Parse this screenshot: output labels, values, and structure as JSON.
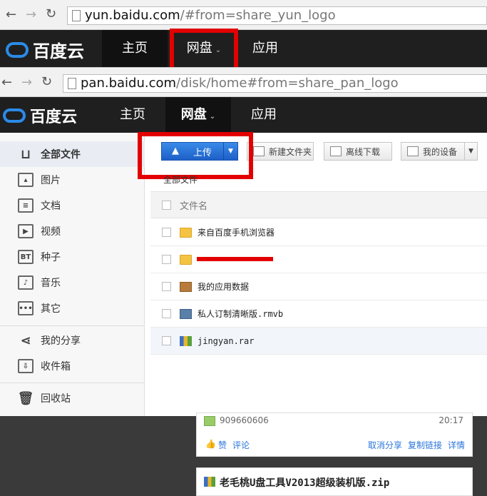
{
  "browser_top": {
    "url_host": "yun.baidu.com",
    "url_rest": "/#from=share_yun_logo"
  },
  "nav_top": {
    "logo": "百度云",
    "items": [
      "主页",
      "网盘",
      "应用"
    ]
  },
  "browser_second": {
    "url_host": "pan.baidu.com",
    "url_rest": "/disk/home#from=share_pan_logo"
  },
  "nav_second": {
    "logo": "百度云",
    "items": [
      "主页",
      "网盘",
      "应用"
    ]
  },
  "sidebar": {
    "items": [
      {
        "label": "全部文件",
        "icon": "folder-tray-icon"
      },
      {
        "label": "图片",
        "icon": "image-icon"
      },
      {
        "label": "文档",
        "icon": "document-icon"
      },
      {
        "label": "视频",
        "icon": "video-icon"
      },
      {
        "label": "种子",
        "icon": "bt-icon",
        "glyph": "BT"
      },
      {
        "label": "音乐",
        "icon": "music-icon"
      },
      {
        "label": "其它",
        "icon": "more-icon"
      },
      {
        "label": "我的分享",
        "icon": "share-icon"
      },
      {
        "label": "收件箱",
        "icon": "inbox-icon"
      },
      {
        "label": "回收站",
        "icon": "trash-icon"
      }
    ]
  },
  "toolbar": {
    "upload": "上传",
    "new_folder": "新建文件夹",
    "offline_download": "离线下载",
    "my_device": "我的设备"
  },
  "breadcrumb": "全部文件",
  "table": {
    "header": "文件名",
    "rows": [
      {
        "name": "来自百度手机浏览器",
        "type": "folder"
      },
      {
        "name": "",
        "type": "folder"
      },
      {
        "name": "我的应用数据",
        "type": "briefcase"
      },
      {
        "name": "私人订制清晰版.rmvb",
        "type": "video"
      },
      {
        "name": "jingyan.rar",
        "type": "rar"
      }
    ]
  },
  "feed": {
    "user_id": "909660606",
    "time": "20:17",
    "like": "赞",
    "comment": "评论",
    "cancel_share": "取消分享",
    "copy_link": "复制链接",
    "detail": "详情",
    "next_file": "老毛桃U盘工具V2013超级装机版.zip"
  },
  "colors": {
    "accent_red": "#e30000",
    "nav_bg": "#1f1f1f",
    "upload_blue": "#2a75dc"
  }
}
